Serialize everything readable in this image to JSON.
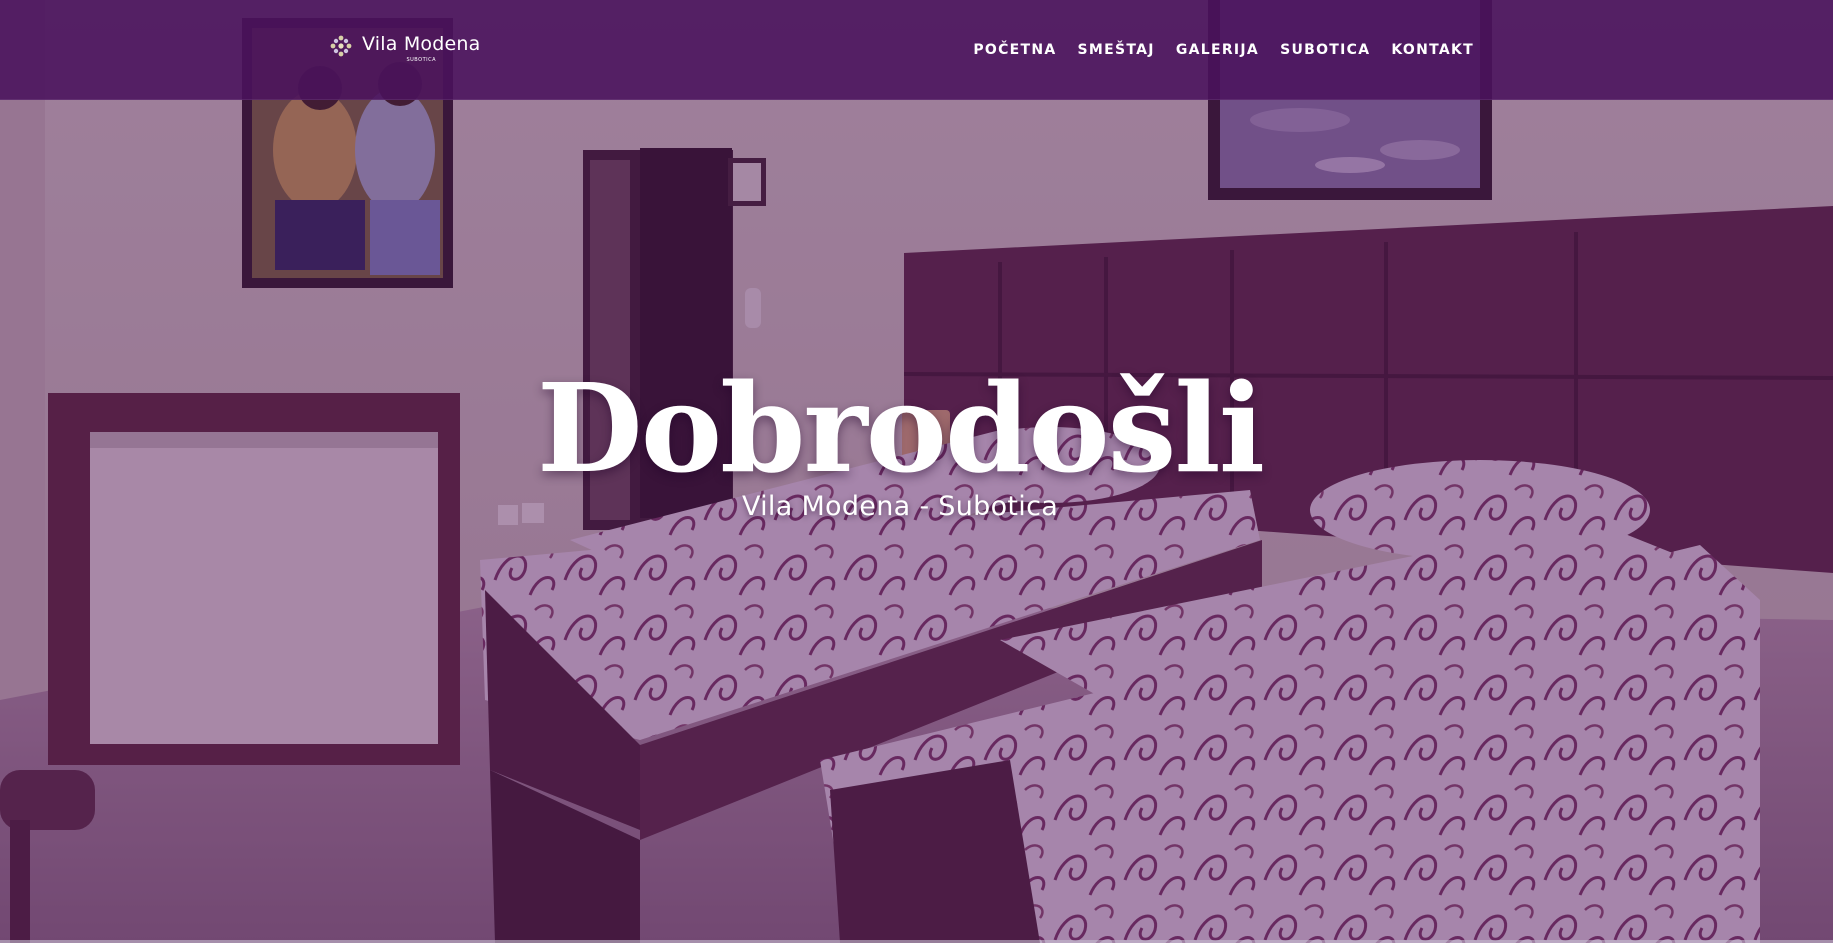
{
  "header": {
    "logo": {
      "name": "Vila Modena",
      "sub": "SUBOTICA",
      "icon": "flower-dots-icon"
    },
    "nav": [
      {
        "label": "POČETNA"
      },
      {
        "label": "SMEŠTAJ"
      },
      {
        "label": "GALERIJA"
      },
      {
        "label": "SUBOTICA"
      },
      {
        "label": "KONTAKT"
      }
    ]
  },
  "hero": {
    "title": "Dobrodošli",
    "subtitle": "Vila Modena - Subotica"
  },
  "colors": {
    "header_bg": "#4a125c",
    "tint": "#4e145c",
    "text": "#ffffff"
  }
}
